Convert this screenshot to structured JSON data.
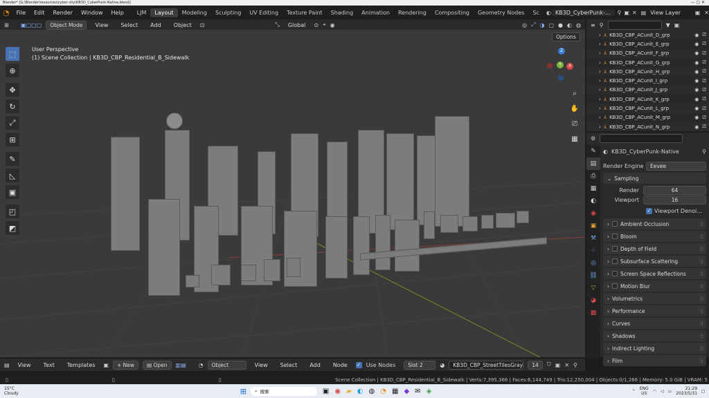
{
  "titlebar": {
    "text": "Blender* [G:\\Blender\\resources\\cyber city\\KB3D_CyberPunk-Native.blend]"
  },
  "menu": [
    "File",
    "Edit",
    "Render",
    "Window",
    "Help"
  ],
  "workspaces": [
    "LJM",
    "Layout",
    "Modeling",
    "Sculpting",
    "UV Editing",
    "Texture Paint",
    "Shading",
    "Animation",
    "Rendering",
    "Compositing",
    "Geometry Nodes",
    "Sc"
  ],
  "scene_name": "KB3D_CyberPunk-...",
  "view_layer": "View Layer",
  "viewport": {
    "mode": "Object Mode",
    "menus": [
      "View",
      "Select",
      "Add",
      "Object"
    ],
    "transform": "Global",
    "options": "Options",
    "overlay_title": "User Perspective",
    "overlay_sub": "(1) Scene Collection | KB3D_CBP_Residential_B_Sidewalk",
    "gizmo": {
      "z": "Z",
      "y": "Y",
      "x": "X"
    }
  },
  "outliner": {
    "items": [
      "KB3D_CBP_ACunit_D_grp",
      "KB3D_CBP_ACunit_E_grp",
      "KB3D_CBP_ACunit_F_grp",
      "KB3D_CBP_ACunit_G_grp",
      "KB3D_CBP_ACunit_H_grp",
      "KB3D_CBP_ACunit_I_grp",
      "KB3D_CBP_ACunit_J_grp",
      "KB3D_CBP_ACunit_K_grp",
      "KB3D_CBP_ACunit_L_grp",
      "KB3D_CBP_ACunit_M_grp",
      "KB3D_CBP_ACunit_N_grp"
    ]
  },
  "properties": {
    "scene": "KB3D_CyberPunk-Native",
    "render_engine_label": "Render Engine",
    "render_engine": "Eevee",
    "sampling": "Sampling",
    "render_label": "Render",
    "render_value": "64",
    "viewport_label": "Viewport",
    "viewport_value": "16",
    "denoise": "Viewport Denoi...",
    "panels": [
      "Ambient Occlusion",
      "Bloom",
      "Depth of Field",
      "Subsurface Scattering",
      "Screen Space Reflections",
      "Motion Blur",
      "Volumetrics",
      "Performance",
      "Curves",
      "Shadows",
      "Indirect Lighting",
      "Film"
    ]
  },
  "bottom": {
    "menus": [
      "View",
      "Text",
      "Templates"
    ],
    "new": "New",
    "open": "Open",
    "object": "Object",
    "menus2": [
      "View",
      "Select",
      "Add",
      "Node"
    ],
    "use_nodes": "Use Nodes",
    "slot": "Slot 2",
    "material": "KB3D_CBP_StreetTilesGrayC",
    "users": "14"
  },
  "status": {
    "text": "Scene Collection | KB3D_CBP_Residential_B_Sidewalk | Verts:7,395,366 | Faces:6,144,749 | Tris:12,250,004 | Objects:0/1,266 | Memory: 5.0 GiB | VRAM: 5"
  },
  "taskbar": {
    "weather_temp": "15°C",
    "weather_desc": "Cloudy",
    "search": "搜索",
    "lang": "ENG",
    "region": "US",
    "time": "21:29",
    "date": "2023/5/31"
  },
  "colors": {
    "accent": "#4772b3",
    "x_axis": "#d24a4a",
    "y_axis": "#7fb33a",
    "z_axis": "#3a7fd2"
  }
}
